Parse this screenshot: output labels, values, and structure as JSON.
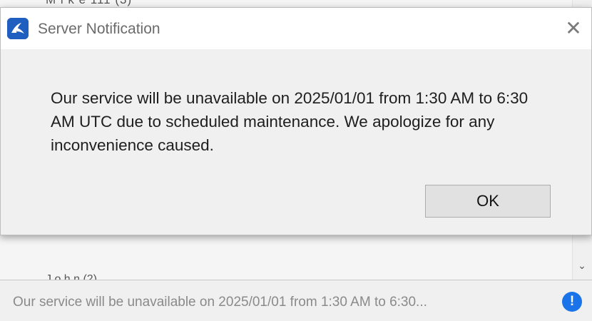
{
  "background": {
    "top_text": "M i k e  111 (3)",
    "mid_text": "J o h n  (2)",
    "scroll_down_icon": "chevron-down-icon"
  },
  "dialog": {
    "title": "Server Notification",
    "app_icon": "app-logo-icon",
    "close_icon": "close-icon",
    "message": "Our service will be unavailable on 2025/01/01 from 1:30 AM to 6:30 AM UTC due to scheduled maintenance. We apologize for any inconvenience caused.",
    "ok_label": "OK"
  },
  "status_bar": {
    "text": "Our service will be unavailable on 2025/01/01 from 1:30 AM to 6:30...",
    "info_icon": "info-icon",
    "info_glyph": "!",
    "info_color": "#1a73e8"
  }
}
